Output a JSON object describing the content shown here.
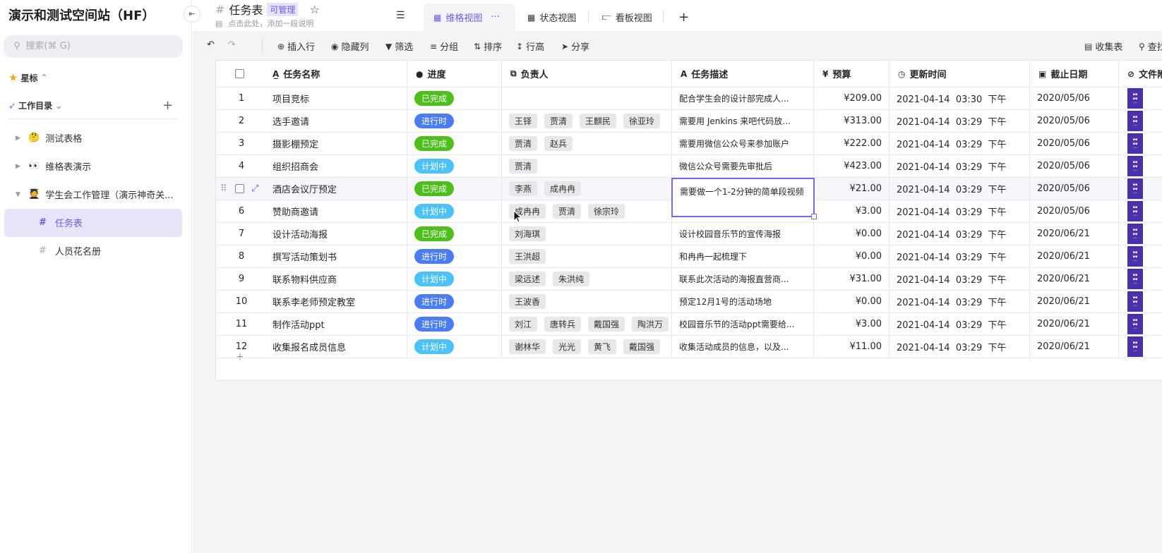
{
  "workspace": {
    "title": "演示和测试空间站（HF）",
    "search_placeholder": "搜索(⌘ G)",
    "starred": "星标",
    "catalog": "工作目录",
    "tree": [
      {
        "emoji": "🤔",
        "label": "测试表格"
      },
      {
        "emoji": "👀",
        "label": "维格表演示"
      },
      {
        "emoji": "🧑‍🎓",
        "label": "学生会工作管理（演示神奇关..."
      }
    ],
    "leaves": [
      {
        "label": "任务表"
      },
      {
        "label": "人员花名册"
      }
    ]
  },
  "header": {
    "title": "任务表",
    "badge": "可管理",
    "subtitle": "点击此处，添加一段说明",
    "tabs": [
      {
        "label": "维格视图",
        "more": "···"
      },
      {
        "label": "状态视图"
      },
      {
        "label": "看板视图"
      }
    ],
    "add_tab": "+"
  },
  "toolbar": {
    "insert_row": "插入行",
    "hide_columns": "隐藏列",
    "filter": "筛选",
    "group": "分组",
    "sort": "排序",
    "row_height": "行高",
    "share": "分享",
    "form": "收集表",
    "find": "查找"
  },
  "columns": [
    "任务名称",
    "进度",
    "负责人",
    "任务描述",
    "预算",
    "更新时间",
    "截止日期",
    "文件附件"
  ],
  "status_colors": {
    "已完成": "#4cbf1c",
    "进行时": "#4a7cf7",
    "计划中": "#4cc3f8"
  },
  "rows": [
    {
      "num": "1",
      "name": "项目竞标",
      "status": "已完成",
      "people": [],
      "desc": "配合学生会的设计部完成人...",
      "budget": "¥209.00",
      "updated": "2021-04-14  03:30  下午",
      "deadline": "2020/05/06"
    },
    {
      "num": "2",
      "name": "选手邀请",
      "status": "进行时",
      "people": [
        "王铎",
        "贾清",
        "王麒民",
        "徐亚玲"
      ],
      "desc": "需要用 Jenkins 来吧代码放...",
      "budget": "¥313.00",
      "updated": "2021-04-14  03:29  下午",
      "deadline": "2020/05/06"
    },
    {
      "num": "3",
      "name": "摄影棚预定",
      "status": "已完成",
      "people": [
        "贾清",
        "赵兵"
      ],
      "desc": "需要用微信公众号来参加账户",
      "budget": "¥222.00",
      "updated": "2021-04-14  03:29  下午",
      "deadline": "2020/05/06"
    },
    {
      "num": "4",
      "name": "组织招商会",
      "status": "计划中",
      "people": [
        "贾清"
      ],
      "desc": "微信公众号需要先审批后",
      "budget": "¥423.00",
      "updated": "2021-04-14  03:29  下午",
      "deadline": "2020/05/06"
    },
    {
      "num": "5",
      "name": "酒店会议厅预定",
      "status": "已完成",
      "people": [
        "李燕",
        "成冉冉"
      ],
      "desc": "需要做一个1-2分钟的简单段视频",
      "budget": "¥21.00",
      "updated": "2021-04-14  03:29  下午",
      "deadline": "2020/05/06"
    },
    {
      "num": "6",
      "name": "赞助商邀请",
      "status": "计划中",
      "people": [
        "成冉冉",
        "贾清",
        "徐宗玲"
      ],
      "desc": "",
      "budget": "¥3.00",
      "updated": "2021-04-14  03:29  下午",
      "deadline": "2020/05/06"
    },
    {
      "num": "7",
      "name": "设计活动海报",
      "status": "已完成",
      "people": [
        "刘海琪"
      ],
      "desc": "设计校园音乐节的宣传海报",
      "budget": "¥0.00",
      "updated": "2021-04-14  03:29  下午",
      "deadline": "2020/06/21"
    },
    {
      "num": "8",
      "name": "撰写活动策划书",
      "status": "进行时",
      "people": [
        "王洪超"
      ],
      "desc": "和冉冉一起梳理下",
      "budget": "¥0.00",
      "updated": "2021-04-14  03:29  下午",
      "deadline": "2020/06/21"
    },
    {
      "num": "9",
      "name": "联系物料供应商",
      "status": "计划中",
      "people": [
        "梁远述",
        "朱洪纯"
      ],
      "desc": "联系此次活动的海报直营商...",
      "budget": "¥31.00",
      "updated": "2021-04-14  03:29  下午",
      "deadline": "2020/06/21"
    },
    {
      "num": "10",
      "name": "联系李老师预定教室",
      "status": "进行时",
      "people": [
        "王波香"
      ],
      "desc": "预定12月1号的活动场地",
      "budget": "¥0.00",
      "updated": "2021-04-14  03:29  下午",
      "deadline": "2020/06/21"
    },
    {
      "num": "11",
      "name": "制作活动ppt",
      "status": "进行时",
      "people": [
        "刘江",
        "唐转兵",
        "戴国强",
        "陶洪万"
      ],
      "desc": "校园音乐节的活动ppt需要给...",
      "budget": "¥3.00",
      "updated": "2021-04-14  03:29  下午",
      "deadline": "2020/06/21"
    },
    {
      "num": "12",
      "name": "收集报名成员信息",
      "status": "计划中",
      "people": [
        "谢林华",
        "光光",
        "黄飞",
        "戴国强"
      ],
      "desc": "收集活动成员的信息，以及...",
      "budget": "¥11.00",
      "updated": "2021-04-14  03:29  下午",
      "deadline": "2020/06/21"
    }
  ],
  "editing_cell": {
    "value": "需要做一个1-2分钟的简单段视频"
  },
  "add_row": "+"
}
